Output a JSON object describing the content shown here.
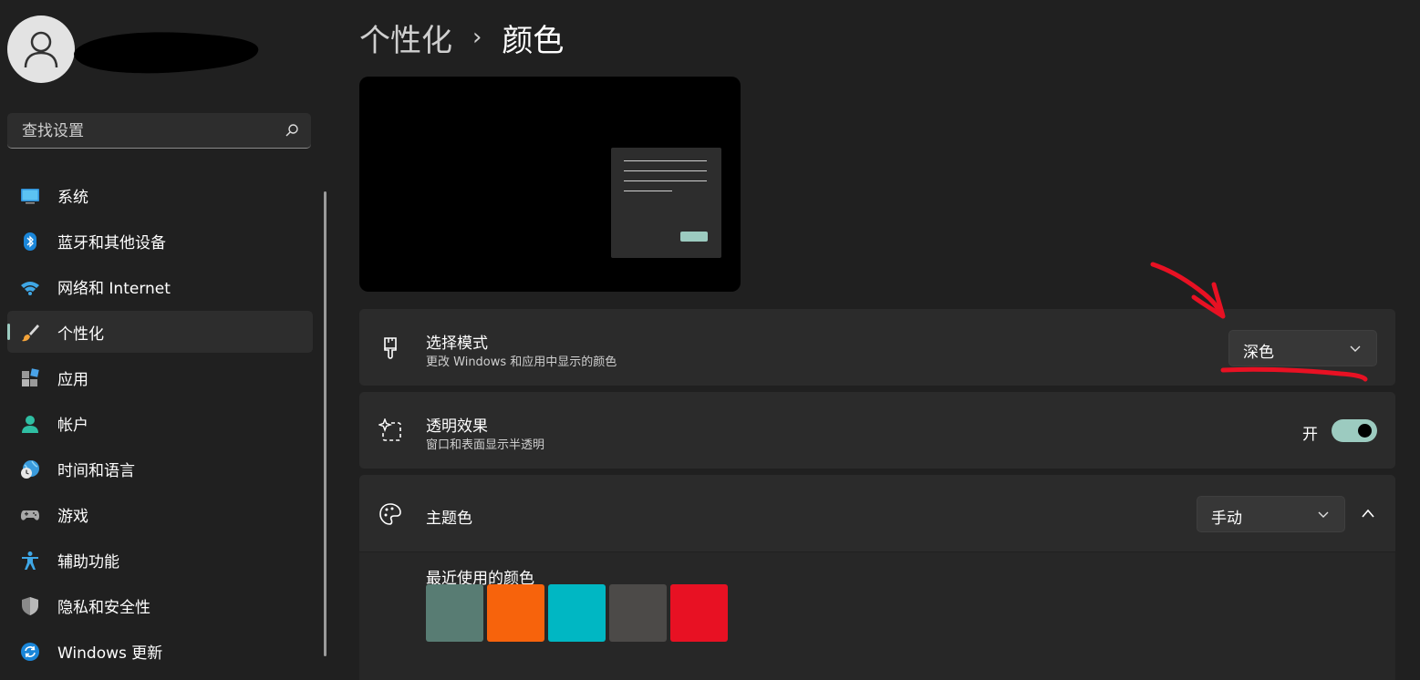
{
  "sidebar": {
    "search": {
      "placeholder": "查找设置"
    },
    "items": [
      {
        "label": "系统",
        "icon": "monitor-icon",
        "active": false
      },
      {
        "label": "蓝牙和其他设备",
        "icon": "bluetooth-icon",
        "active": false
      },
      {
        "label": "网络和 Internet",
        "icon": "wifi-icon",
        "active": false
      },
      {
        "label": "个性化",
        "icon": "brush-icon",
        "active": true
      },
      {
        "label": "应用",
        "icon": "apps-icon",
        "active": false
      },
      {
        "label": "帐户",
        "icon": "account-icon",
        "active": false
      },
      {
        "label": "时间和语言",
        "icon": "globe-clock-icon",
        "active": false
      },
      {
        "label": "游戏",
        "icon": "gamepad-icon",
        "active": false
      },
      {
        "label": "辅助功能",
        "icon": "accessibility-icon",
        "active": false
      },
      {
        "label": "隐私和安全性",
        "icon": "shield-icon",
        "active": false
      },
      {
        "label": "Windows 更新",
        "icon": "update-icon",
        "active": false
      }
    ]
  },
  "header": {
    "parent": "个性化",
    "separator": "›",
    "current": "颜色"
  },
  "settings": {
    "mode": {
      "title": "选择模式",
      "subtitle": "更改 Windows 和应用中显示的颜色",
      "value": "深色",
      "icon": "paintbrush-icon"
    },
    "transparency": {
      "title": "透明效果",
      "subtitle": "窗口和表面显示半透明",
      "state_label": "开",
      "on": true,
      "icon": "sparkle-icon"
    },
    "accent": {
      "title": "主题色",
      "value": "手动",
      "icon": "palette-icon",
      "expanded": true,
      "recent_title": "最近使用的颜色",
      "recent_colors": [
        "#587c73",
        "#f7630c",
        "#00b7c3",
        "#4c4a48",
        "#e81123"
      ]
    }
  },
  "colors": {
    "accent": "#9ccbc0",
    "annotation": "#e81123"
  }
}
